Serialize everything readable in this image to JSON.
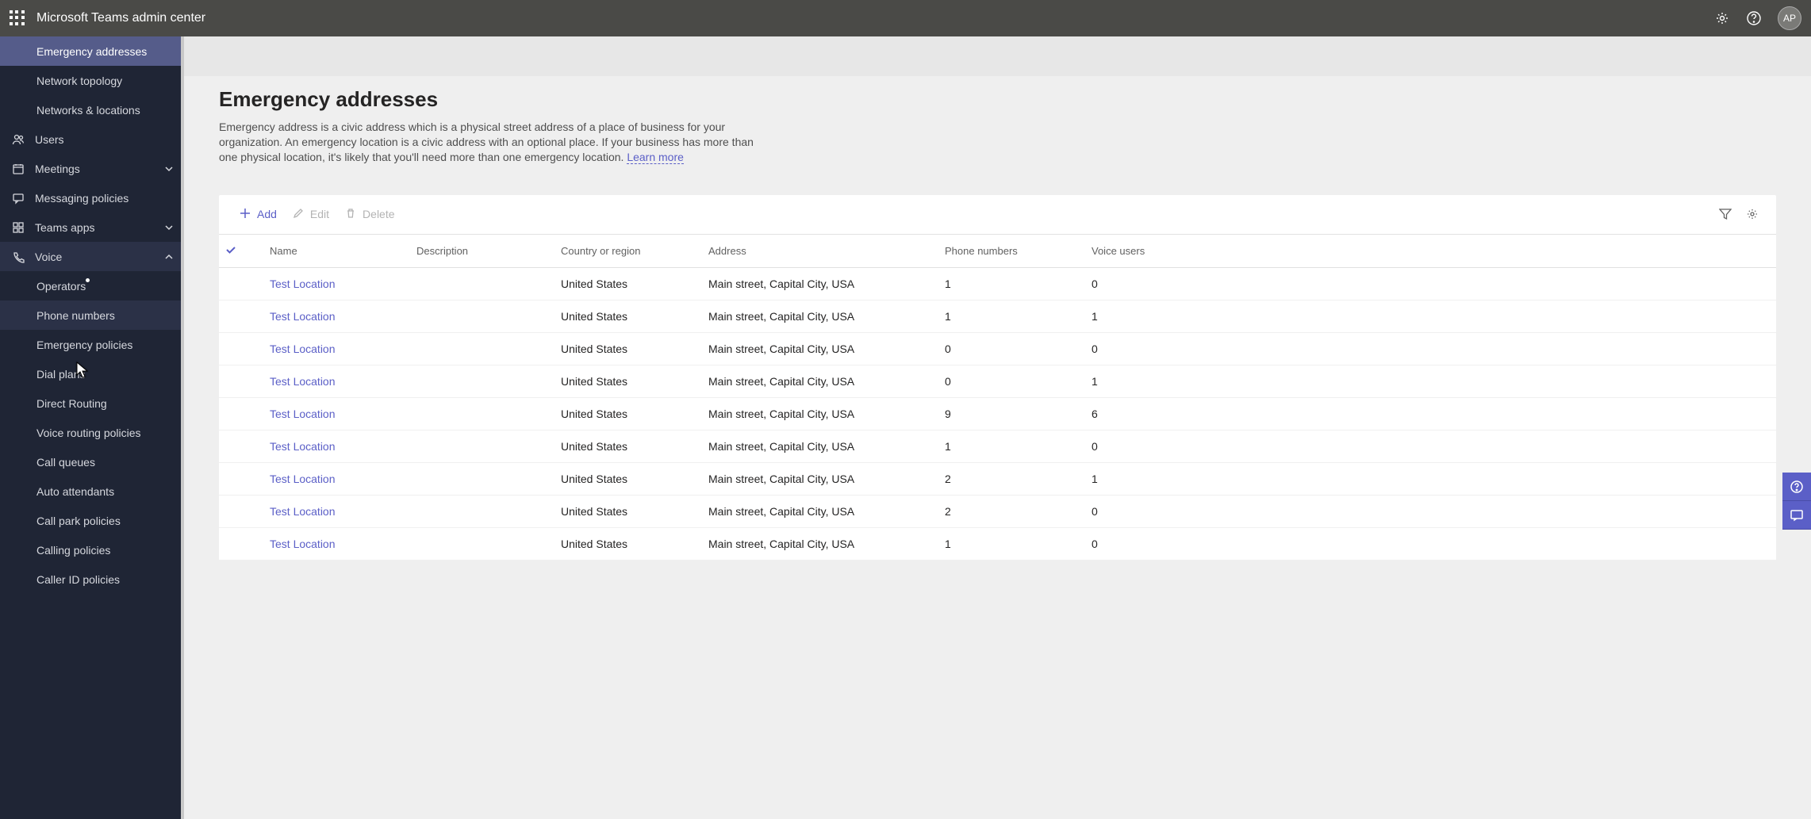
{
  "header": {
    "app_title": "Microsoft Teams admin center",
    "avatar_initials": "AP"
  },
  "sidebar": {
    "items": [
      {
        "id": "emergency-addresses",
        "label": "Emergency addresses",
        "icon": "",
        "sub": true,
        "active": true
      },
      {
        "id": "network-topology",
        "label": "Network topology",
        "icon": "",
        "sub": true
      },
      {
        "id": "networks-locations",
        "label": "Networks & locations",
        "icon": "",
        "sub": true
      },
      {
        "id": "users",
        "label": "Users",
        "icon": "users"
      },
      {
        "id": "meetings",
        "label": "Meetings",
        "icon": "meetings",
        "chevron": "down"
      },
      {
        "id": "messaging-policies",
        "label": "Messaging policies",
        "icon": "messaging"
      },
      {
        "id": "teams-apps",
        "label": "Teams apps",
        "icon": "apps",
        "chevron": "down"
      },
      {
        "id": "voice",
        "label": "Voice",
        "icon": "voice",
        "chevron": "up",
        "highlight": true
      },
      {
        "id": "operators",
        "label": "Operators",
        "icon": "",
        "sub": true,
        "dot": true
      },
      {
        "id": "phone-numbers",
        "label": "Phone numbers",
        "icon": "",
        "sub": true,
        "highlight": true
      },
      {
        "id": "emergency-policies",
        "label": "Emergency policies",
        "icon": "",
        "sub": true
      },
      {
        "id": "dial-plans",
        "label": "Dial plans",
        "icon": "",
        "sub": true
      },
      {
        "id": "direct-routing",
        "label": "Direct Routing",
        "icon": "",
        "sub": true
      },
      {
        "id": "voice-routing-policies",
        "label": "Voice routing policies",
        "icon": "",
        "sub": true
      },
      {
        "id": "call-queues",
        "label": "Call queues",
        "icon": "",
        "sub": true
      },
      {
        "id": "auto-attendants",
        "label": "Auto attendants",
        "icon": "",
        "sub": true
      },
      {
        "id": "call-park-policies",
        "label": "Call park policies",
        "icon": "",
        "sub": true
      },
      {
        "id": "calling-policies",
        "label": "Calling policies",
        "icon": "",
        "sub": true
      },
      {
        "id": "caller-id-policies",
        "label": "Caller ID policies",
        "icon": "",
        "sub": true
      }
    ]
  },
  "page": {
    "title": "Emergency addresses",
    "description_pre": "Emergency address is a civic address which is a physical street address of a place of business for your organization. An emergency location is a civic address with an optional place. If your business has more than one physical location, it's likely that you'll need more than one emergency location. ",
    "learn_more": "Learn more"
  },
  "toolbar": {
    "add": "Add",
    "edit": "Edit",
    "delete": "Delete"
  },
  "table": {
    "columns": {
      "name": "Name",
      "description": "Description",
      "country": "Country or region",
      "address": "Address",
      "phone": "Phone numbers",
      "voice": "Voice users"
    },
    "rows": [
      {
        "name": "Test Location",
        "description": "",
        "country": "United States",
        "address": "Main street, Capital City, USA",
        "phone": "1",
        "voice": "0"
      },
      {
        "name": "Test Location",
        "description": "",
        "country": "United States",
        "address": "Main street, Capital City, USA",
        "phone": "1",
        "voice": "1"
      },
      {
        "name": "Test Location",
        "description": "",
        "country": "United States",
        "address": "Main street, Capital City, USA",
        "phone": "0",
        "voice": "0"
      },
      {
        "name": "Test Location",
        "description": "",
        "country": "United States",
        "address": "Main street, Capital City, USA",
        "phone": "0",
        "voice": "1"
      },
      {
        "name": "Test Location",
        "description": "",
        "country": "United States",
        "address": "Main street, Capital City, USA",
        "phone": "9",
        "voice": "6"
      },
      {
        "name": "Test Location",
        "description": "",
        "country": "United States",
        "address": "Main street, Capital City, USA",
        "phone": "1",
        "voice": "0"
      },
      {
        "name": "Test Location",
        "description": "",
        "country": "United States",
        "address": "Main street, Capital City, USA",
        "phone": "2",
        "voice": "1"
      },
      {
        "name": "Test Location",
        "description": "",
        "country": "United States",
        "address": "Main street, Capital City, USA",
        "phone": "2",
        "voice": "0"
      },
      {
        "name": "Test Location",
        "description": "",
        "country": "United States",
        "address": "Main street, Capital City, USA",
        "phone": "1",
        "voice": "0"
      }
    ]
  }
}
